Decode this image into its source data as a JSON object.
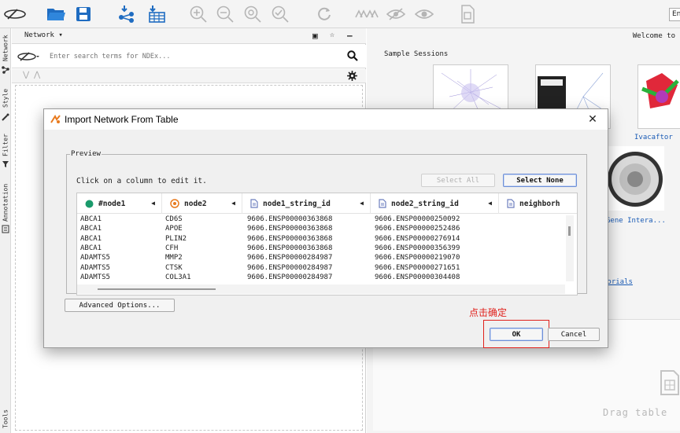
{
  "toolbar": {
    "icons": [
      "ndex-logo-icon",
      "open-folder-icon",
      "save-icon",
      "import-network-icon",
      "import-table-icon",
      "zoom-in-icon",
      "zoom-out-icon",
      "zoom-fit-icon",
      "zoom-selected-icon",
      "refresh-icon",
      "hide-all-icon",
      "hide-selected-icon",
      "show-all-icon",
      "export-icon"
    ],
    "language_value": "En"
  },
  "rail": {
    "items": [
      "Network",
      "Style",
      "Filter",
      "Annotation",
      "Tools"
    ]
  },
  "network_panel": {
    "title": "Network ▾",
    "search_placeholder": "Enter search terms for NDEx..."
  },
  "right_panel": {
    "welcome": "Welcome to",
    "sample_sessions_label": "Sample Sessions",
    "thumb_captions": [
      "Ivacaftor",
      "Gene Intera..."
    ],
    "tutorials_link": "torials",
    "drag_text": "Drag table"
  },
  "dialog": {
    "title": "Import Network From Table",
    "preview_legend": "Preview",
    "hint": "Click on a column to edit it.",
    "select_all": "Select All",
    "select_none": "Select None",
    "columns": [
      {
        "name": "#node1",
        "type": "source"
      },
      {
        "name": "node2",
        "type": "target"
      },
      {
        "name": "node1_string_id",
        "type": "attribute"
      },
      {
        "name": "node2_string_id",
        "type": "attribute"
      },
      {
        "name": "neighborh",
        "type": "attribute"
      }
    ],
    "rows": [
      [
        "ABCA1",
        "CD6S",
        "9606.ENSP00000363868",
        "9606.ENSP00000250092"
      ],
      [
        "ABCA1",
        "APOE",
        "9606.ENSP00000363868",
        "9606.ENSP00000252486"
      ],
      [
        "ABCA1",
        "PLIN2",
        "9606.ENSP00000363868",
        "9606.ENSP00000276914"
      ],
      [
        "ABCA1",
        "CFH",
        "9606.ENSP00000363868",
        "9606.ENSP00000356399"
      ],
      [
        "ADAMTS5",
        "MMP2",
        "9606.ENSP00000284987",
        "9606.ENSP00000219070"
      ],
      [
        "ADAMTS5",
        "CTSK",
        "9606.ENSP00000284987",
        "9606.ENSP00000271651"
      ],
      [
        "ADAMTS5",
        "COL3A1",
        "9606.ENSP00000284987",
        "9606.ENSP00000304408"
      ]
    ],
    "advanced_options": "Advanced Options...",
    "ok": "OK",
    "cancel": "Cancel"
  },
  "annotation": {
    "text": "点击确定",
    "color": "#e0201b"
  },
  "colors": {
    "accent_blue": "#1f6cc1",
    "source_green": "#1a9a6b",
    "target_orange": "#e87a1e"
  }
}
